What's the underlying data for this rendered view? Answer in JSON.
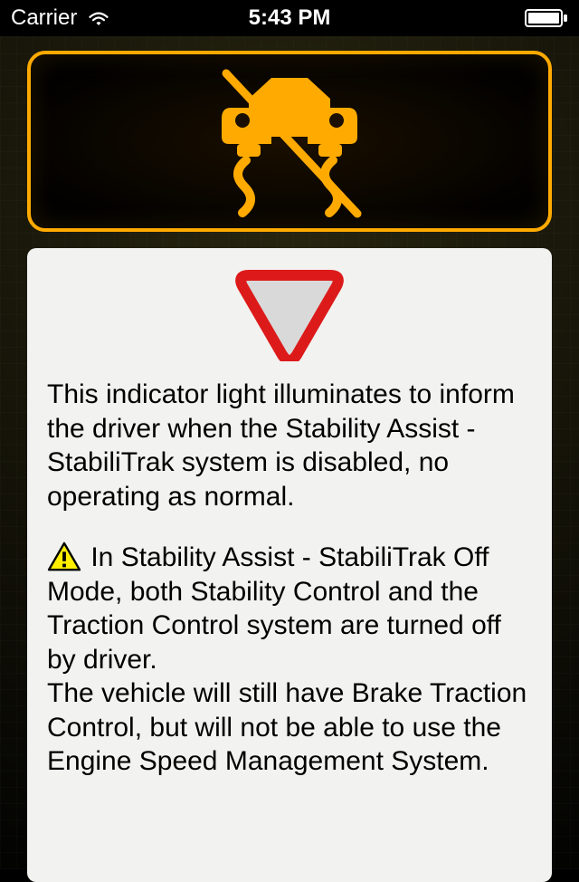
{
  "status_bar": {
    "carrier": "Carrier",
    "time": "5:43 PM"
  },
  "icons": {
    "indicator": "car-skid-stability-off",
    "yield": "yield-triangle",
    "warning": "warning-triangle"
  },
  "info": {
    "paragraph1": "This indicator light illuminates to inform the driver when the Stability Assist - StabiliTrak system is disabled, no operating as normal.",
    "warning_text": " In Stability Assist - StabiliTrak Off Mode, both Stability Control and the Traction Control system are turned off by driver.",
    "paragraph3": "The vehicle will still have Brake Traction Control, but will not be able to use the Engine Speed Management System."
  }
}
